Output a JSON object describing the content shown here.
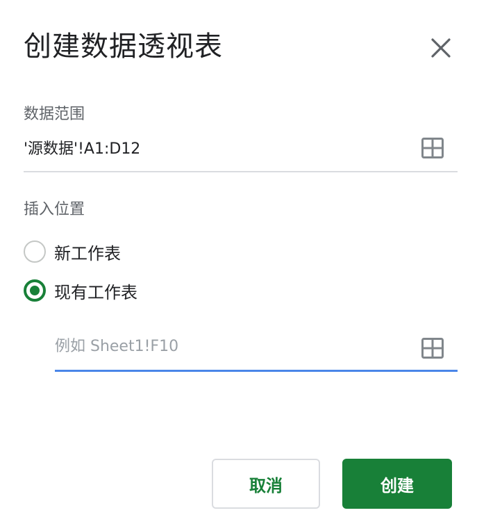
{
  "dialog": {
    "title": "创建数据透视表",
    "close_icon": "close-icon"
  },
  "data_range": {
    "label": "数据范围",
    "value": "'源数据'!A1:D12",
    "icon": "grid-select-icon"
  },
  "insert_location": {
    "label": "插入位置",
    "options": [
      {
        "label": "新工作表",
        "selected": false
      },
      {
        "label": "现有工作表",
        "selected": true
      }
    ],
    "input_placeholder": "例如 Sheet1!F10",
    "input_value": "",
    "icon": "grid-select-icon"
  },
  "buttons": {
    "cancel": "取消",
    "create": "创建"
  },
  "colors": {
    "accent_green": "#188038",
    "focus_blue": "#4a86e8",
    "muted_text": "#5f6368",
    "divider": "#dadce0"
  }
}
